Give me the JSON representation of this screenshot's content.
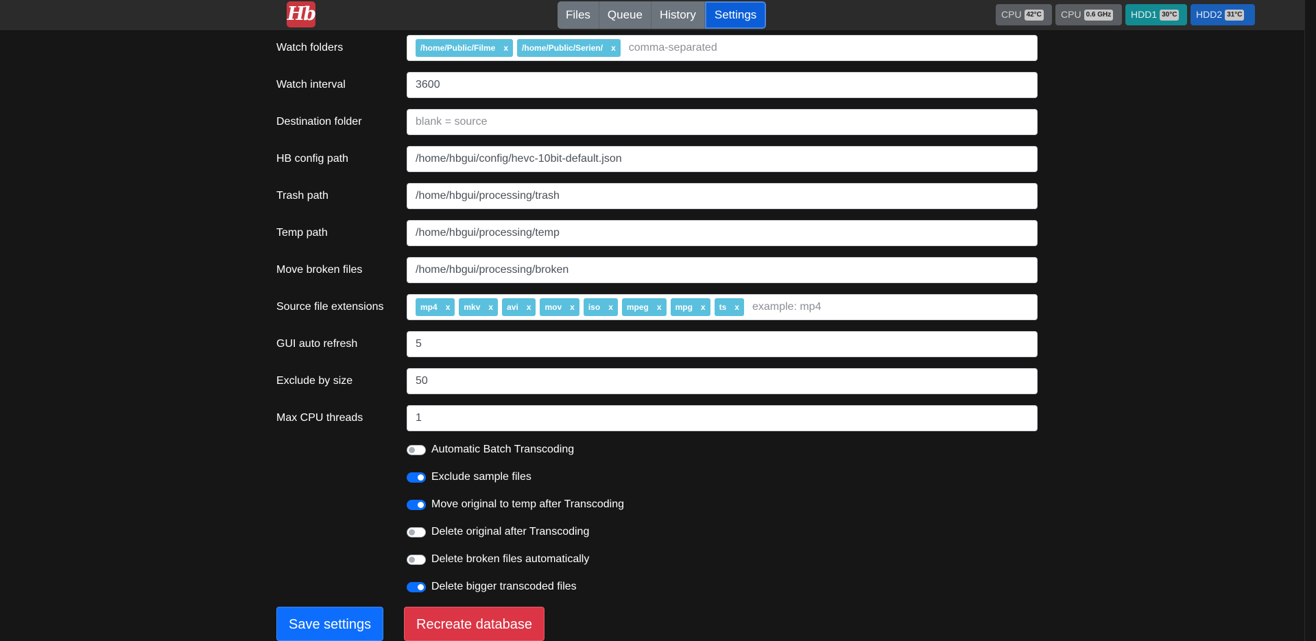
{
  "navbar": {
    "logo_text": "Hb",
    "tabs": [
      {
        "label": "Files"
      },
      {
        "label": "Queue"
      },
      {
        "label": "History"
      },
      {
        "label": "Settings",
        "active": true
      }
    ],
    "status_badges": [
      {
        "label": "CPU",
        "value": "42°C"
      },
      {
        "label": "CPU",
        "value": "0.6 GHz"
      },
      {
        "label": "HDD1",
        "value": "30°C"
      },
      {
        "label": "HDD2",
        "value": "31°C"
      }
    ]
  },
  "settings": {
    "watch_folders": {
      "label": "Watch folders",
      "tags": [
        "/home/Public/Filme",
        "/home/Public/Serien/"
      ],
      "placeholder": "comma-separated"
    },
    "watch_interval": {
      "label": "Watch interval",
      "value": "3600"
    },
    "destination_folder": {
      "label": "Destination folder",
      "placeholder": "blank = source"
    },
    "hb_config_path": {
      "label": "HB config path",
      "value": "/home/hbgui/config/hevc-10bit-default.json"
    },
    "trash_path": {
      "label": "Trash path",
      "value": "/home/hbgui/processing/trash"
    },
    "temp_path": {
      "label": "Temp path",
      "value": "/home/hbgui/processing/temp"
    },
    "move_broken_files": {
      "label": "Move broken files",
      "value": "/home/hbgui/processing/broken"
    },
    "source_file_extensions": {
      "label": "Source file extensions",
      "tags": [
        "mp4",
        "mkv",
        "avi",
        "mov",
        "iso",
        "mpeg",
        "mpg",
        "ts"
      ],
      "placeholder": "example: mp4"
    },
    "gui_auto_refresh": {
      "label": "GUI auto refresh",
      "value": "5"
    },
    "exclude_by_size": {
      "label": "Exclude by size",
      "value": "50"
    },
    "max_cpu_threads": {
      "label": "Max CPU threads",
      "value": "1"
    },
    "tag_remove_glyph": "x"
  },
  "toggles": [
    {
      "label": "Automatic Batch Transcoding",
      "checked": false
    },
    {
      "label": "Exclude sample files",
      "checked": true
    },
    {
      "label": "Move original to temp after Transcoding",
      "checked": true
    },
    {
      "label": "Delete original after Transcoding",
      "checked": false
    },
    {
      "label": "Delete broken files automatically",
      "checked": false
    },
    {
      "label": "Delete bigger transcoded files",
      "checked": true
    }
  ],
  "actions": {
    "save_label": "Save settings",
    "recreate_label": "Recreate database"
  },
  "colors": {
    "background": "#161616",
    "navbar": "#2b2b2b",
    "accent": "#0d6efd",
    "danger": "#dc3545",
    "tag": "#5bc0de",
    "logo": "#c9363e"
  }
}
